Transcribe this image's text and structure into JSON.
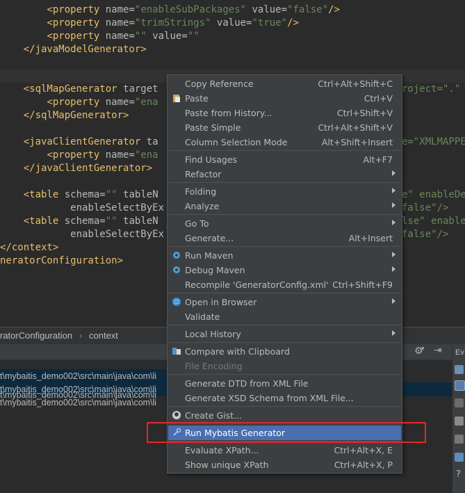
{
  "code": [
    {
      "indent": "        ",
      "parts": [
        [
          "tag",
          "<property "
        ],
        [
          "attr",
          "name="
        ],
        [
          "val",
          "\"enableSubPackages\" "
        ],
        [
          "attr",
          "value="
        ],
        [
          "val",
          "\"false\""
        ],
        [
          "tag",
          "/>"
        ]
      ]
    },
    {
      "indent": "        ",
      "parts": [
        [
          "tag",
          "<property "
        ],
        [
          "attr",
          "name="
        ],
        [
          "val",
          "\"trimStrings\" "
        ],
        [
          "attr",
          "value="
        ],
        [
          "val",
          "\"true\""
        ],
        [
          "tag",
          "/>"
        ]
      ]
    },
    {
      "indent": "        ",
      "parts": [
        [
          "tag",
          "<property "
        ],
        [
          "attr",
          "name="
        ],
        [
          "val",
          "\"\" "
        ],
        [
          "attr",
          "value="
        ],
        [
          "val",
          "\"\""
        ]
      ]
    },
    {
      "indent": "    ",
      "parts": [
        [
          "tag",
          "</javaModelGenerator>"
        ]
      ]
    },
    {
      "indent": "",
      "parts": []
    },
    {
      "indent": "    ",
      "parts": [
        [
          "tag",
          "<sqlMapGenerator "
        ],
        [
          "attr",
          "target"
        ]
      ],
      "right": "roject=\".\""
    },
    {
      "indent": "        ",
      "parts": [
        [
          "tag",
          "<property "
        ],
        [
          "attr",
          "name="
        ],
        [
          "val",
          "\"ena"
        ]
      ]
    },
    {
      "indent": "    ",
      "parts": [
        [
          "tag",
          "</sqlMapGenerator>"
        ]
      ]
    },
    {
      "indent": "",
      "parts": []
    },
    {
      "indent": "    ",
      "parts": [
        [
          "tag",
          "<javaClientGenerator "
        ],
        [
          "attr",
          "ta"
        ]
      ],
      "right": "e=\"XMLMAPPE"
    },
    {
      "indent": "        ",
      "parts": [
        [
          "tag",
          "<property "
        ],
        [
          "attr",
          "name="
        ],
        [
          "val",
          "\"ena"
        ]
      ]
    },
    {
      "indent": "    ",
      "parts": [
        [
          "tag",
          "</javaClientGenerator>"
        ]
      ]
    },
    {
      "indent": "",
      "parts": []
    },
    {
      "indent": "    ",
      "parts": [
        [
          "tag",
          "<table "
        ],
        [
          "attr",
          "schema="
        ],
        [
          "val",
          "\"\" "
        ],
        [
          "attr",
          "tableN"
        ]
      ],
      "right": "e\" enableDe"
    },
    {
      "indent": "            ",
      "parts": [
        [
          "attr",
          "enableSelectByEx"
        ]
      ],
      "right": "false\"/>"
    },
    {
      "indent": "    ",
      "parts": [
        [
          "tag",
          "<table "
        ],
        [
          "attr",
          "schema="
        ],
        [
          "val",
          "\"\" "
        ],
        [
          "attr",
          "tableN"
        ]
      ],
      "right": "lse\" enable"
    },
    {
      "indent": "            ",
      "parts": [
        [
          "attr",
          "enableSelectByEx"
        ]
      ],
      "right": "false\"/>"
    },
    {
      "indent": "",
      "parts": [
        [
          "tag",
          "</context>"
        ]
      ]
    },
    {
      "indent": "",
      "parts": [
        [
          "tag",
          "neratorConfiguration>"
        ]
      ]
    }
  ],
  "breadcrumb": {
    "first": "ratorConfiguration",
    "second": "context"
  },
  "run_lines": [
    "t\\mybaitis_demo002\\src\\main\\java\\com\\li",
    "t\\mybaitis_demo002\\src\\main\\java\\com\\li"
  ],
  "right_strip_label": "Ev",
  "menu": {
    "items": [
      {
        "label": "Copy Reference",
        "shortcut": "Ctrl+Alt+Shift+C"
      },
      {
        "label": "Paste",
        "shortcut": "Ctrl+V",
        "icon": "paste-icon"
      },
      {
        "label": "Paste from History...",
        "shortcut": "Ctrl+Shift+V"
      },
      {
        "label": "Paste Simple",
        "shortcut": "Ctrl+Alt+Shift+V"
      },
      {
        "label": "Column Selection Mode",
        "shortcut": "Alt+Shift+Insert"
      },
      {
        "label": "Find Usages",
        "shortcut": "Alt+F7"
      },
      {
        "label": "Refactor",
        "submenu": true
      },
      {
        "label": "Folding",
        "submenu": true
      },
      {
        "label": "Analyze",
        "submenu": true
      },
      {
        "label": "Go To",
        "submenu": true
      },
      {
        "label": "Generate...",
        "shortcut": "Alt+Insert"
      },
      {
        "label": "Run Maven",
        "submenu": true,
        "icon": "maven-gear-icon"
      },
      {
        "label": "Debug Maven",
        "submenu": true,
        "icon": "maven-debug-icon"
      },
      {
        "label": "Recompile 'GeneratorConfig.xml'",
        "shortcut": "Ctrl+Shift+F9"
      },
      {
        "label": "Open in Browser",
        "submenu": true,
        "icon": "globe-icon"
      },
      {
        "label": "Validate"
      },
      {
        "label": "Local History",
        "submenu": true
      },
      {
        "label": "Compare with Clipboard",
        "icon": "compare-icon"
      },
      {
        "label": "File Encoding",
        "disabled": true
      },
      {
        "label": "Generate DTD from XML File"
      },
      {
        "label": "Generate XSD Schema from XML File..."
      },
      {
        "label": "Create Gist...",
        "icon": "github-icon"
      },
      {
        "label": "Run Mybatis Generator",
        "icon": "mybatis-tool-icon",
        "highlight": true
      },
      {
        "label": "Evaluate XPath...",
        "shortcut": "Ctrl+Alt+X, E"
      },
      {
        "label": "Show unique XPath",
        "shortcut": "Ctrl+Alt+X, P"
      }
    ]
  },
  "colors": {
    "highlight": "#4b6eaf",
    "annotation_box": "#e8262b",
    "background": "#2b2b2b"
  }
}
